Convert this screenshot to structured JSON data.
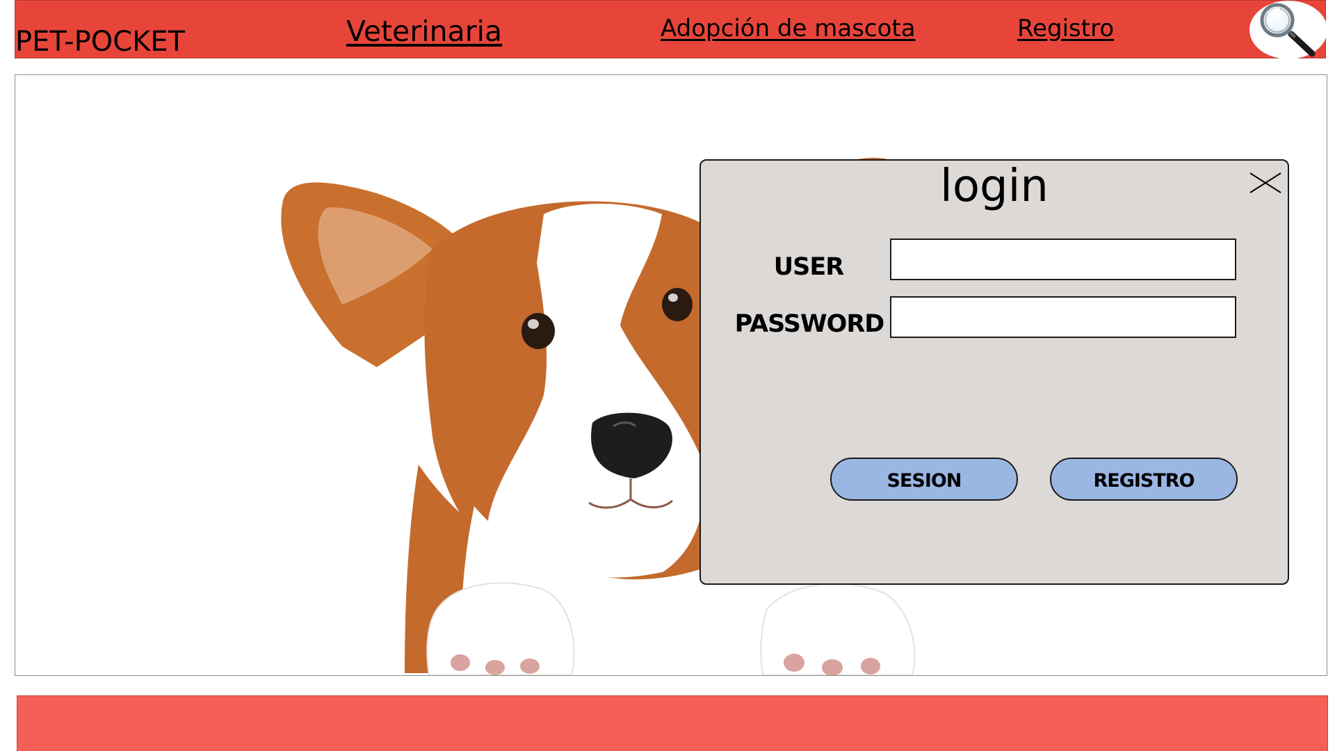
{
  "header": {
    "brand": "PET-POCKET",
    "nav": {
      "veterinaria": "Veterinaria ",
      "adopcion": "Adopción de mascota ",
      "registro": "Registro"
    },
    "search_icon": "magnifying-glass-icon",
    "background_color": "#e8453a"
  },
  "login": {
    "title": "login",
    "close_icon": "close-icon",
    "user_label": "USER",
    "password_label": "PASSWORD",
    "user_value": "",
    "password_value": "",
    "sesion_button": "SESION",
    "registro_button": "REGISTRO",
    "panel_color": "#dcd9d7",
    "button_color": "#9ab7e4"
  },
  "hero": {
    "image": "corgi-puppy-photo"
  },
  "footer": {
    "background_color": "#f55f55"
  }
}
